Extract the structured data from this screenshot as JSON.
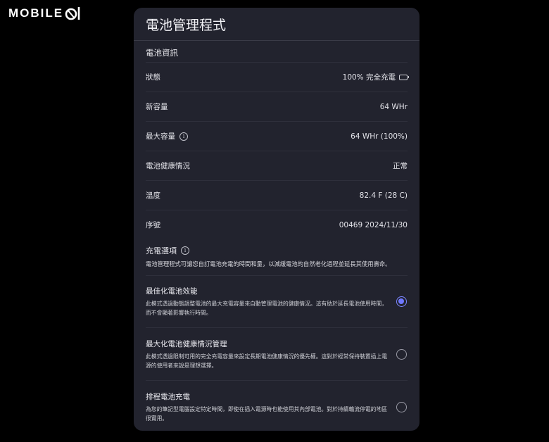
{
  "logo": {
    "text": "MOBILE"
  },
  "app": {
    "title": "電池管理程式"
  },
  "battery_info": {
    "heading": "電池資訊",
    "rows": [
      {
        "label": "狀態",
        "value": "100% 完全充電",
        "icon": "battery-charging-icon"
      },
      {
        "label": "新容量",
        "value": "64 WHr"
      },
      {
        "label": "最大容量",
        "value": "64 WHr (100%)",
        "icon": "info-icon"
      },
      {
        "label": "電池健康情況",
        "value": "正常"
      },
      {
        "label": "溫度",
        "value": "82.4 F (28 C)"
      },
      {
        "label": "序號",
        "value": "00469 2024/11/30"
      }
    ]
  },
  "charge_options": {
    "heading": "充電選項",
    "description": "電池管理程式可讓您自訂電池充電的時間和量，以減緩電池的自然老化過程並延長其使用壽命。",
    "options": [
      {
        "title": "最佳化電池效能",
        "desc1": "此模式透過動態調整電池的最大充電容量來自動管理電池的健康情況。這有助於延長電池使用時間，",
        "desc2": "而不會顯著影響執行時間。",
        "selected": true
      },
      {
        "title": "最大化電池健康情況管理",
        "desc1": "此模式透過限制可用的完全充電容量來設定長期電池健康情況的優先權。這對於經常保持裝置插上電",
        "desc2": "源的使用者來說是理想選擇。",
        "selected": false
      },
      {
        "title": "排程電池充電",
        "desc1": "為您的筆記型電腦設定特定時間，即使在插入電源時也能使用其內部電池。對於持續輪流停電的地區",
        "desc2": "很實用。",
        "selected": false
      }
    ]
  },
  "colors": {
    "background": "#000000",
    "panel": "#22232e",
    "accent": "#6f78ff"
  }
}
